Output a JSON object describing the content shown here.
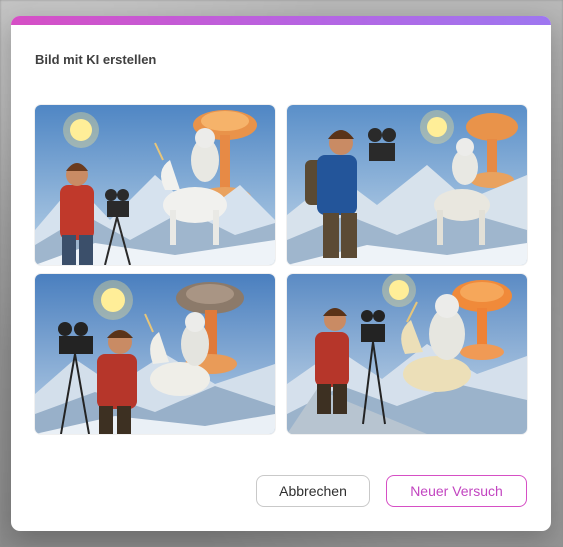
{
  "dialog": {
    "title": "Bild mit KI erstellen",
    "accent_gradient": [
      "#d64fc5",
      "#9e77f0"
    ]
  },
  "images": [
    {
      "name": "generated-image-1"
    },
    {
      "name": "generated-image-2"
    },
    {
      "name": "generated-image-3"
    },
    {
      "name": "generated-image-4"
    }
  ],
  "footer": {
    "cancel_label": "Abbrechen",
    "retry_label": "Neuer Versuch"
  },
  "colors": {
    "retry_accent": "#c245c0",
    "cancel_border": "#c9c9c9"
  }
}
